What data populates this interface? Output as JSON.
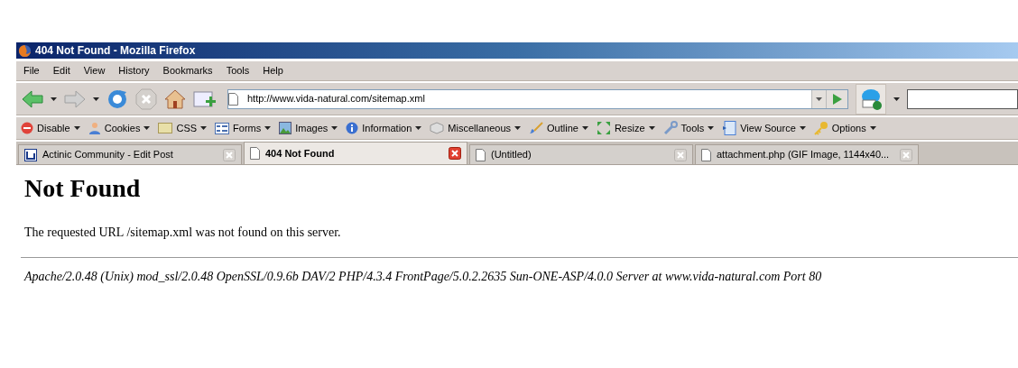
{
  "window": {
    "title": "404 Not Found - Mozilla Firefox"
  },
  "menu": [
    "File",
    "Edit",
    "View",
    "History",
    "Bookmarks",
    "Tools",
    "Help"
  ],
  "address_bar": {
    "value": "http://www.vida-natural.com/sitemap.xml"
  },
  "dev_toolbar": [
    "Disable",
    "Cookies",
    "CSS",
    "Forms",
    "Images",
    "Information",
    "Miscellaneous",
    "Outline",
    "Resize",
    "Tools",
    "View Source",
    "Options"
  ],
  "tabs": [
    {
      "label": "Actinic Community - Edit Post",
      "selected": false,
      "kind": "site"
    },
    {
      "label": "404 Not Found",
      "selected": true,
      "kind": "page"
    },
    {
      "label": "(Untitled)",
      "selected": false,
      "kind": "page"
    },
    {
      "label": "attachment.php (GIF Image, 1144x40...",
      "selected": false,
      "kind": "page"
    }
  ],
  "page": {
    "heading": "Not Found",
    "message": "The requested URL /sitemap.xml was not found on this server.",
    "signature": "Apache/2.0.48 (Unix) mod_ssl/2.0.48 OpenSSL/0.9.6b DAV/2 PHP/4.3.4 FrontPage/5.0.2.2635 Sun-ONE-ASP/4.0.0 Server at www.vida-natural.com Port 80"
  }
}
